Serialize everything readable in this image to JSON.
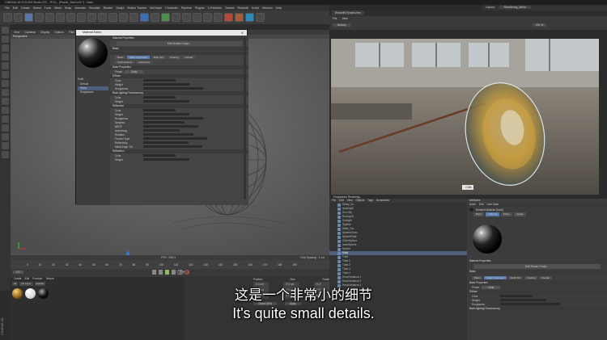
{
  "window": {
    "title": "CINEMA 4D R19.053 Studio (RC - R19) - [Plastic_Start.c4d *] - Main",
    "layout_label": "Layout:",
    "layout_value": "Rendering_direct"
  },
  "menu": [
    "File",
    "Edit",
    "Create",
    "Select",
    "Tools",
    "Mesh",
    "Snap",
    "Animate",
    "Simulate",
    "Render",
    "Sculpt",
    "Motion Tracker",
    "MoGraph",
    "Character",
    "Pipeline",
    "Plugins",
    "X-Particles",
    "Octane",
    "Redshift",
    "Script",
    "Window",
    "Help"
  ],
  "viewport": {
    "menu": [
      "View",
      "Cameras",
      "Display",
      "Options",
      "Filter",
      "Panel"
    ],
    "label": "Perspective",
    "fps": "FPS : 299.3",
    "grid": "Grid Spacing : 1 cm"
  },
  "timeline": {
    "ticks": [
      "0",
      "10",
      "20",
      "30",
      "40",
      "50",
      "60",
      "70",
      "80",
      "90",
      "100",
      "110",
      "120",
      "130",
      "140",
      "150",
      "160",
      "170",
      "180",
      "190"
    ],
    "frame_start": "0 F",
    "frame_end": "90 F"
  },
  "material_manager": {
    "menu": [
      "Create",
      "Edit",
      "Function",
      "Texture"
    ],
    "tabs": [
      "All",
      "No Layer",
      "Default"
    ]
  },
  "coordinates": {
    "headers": [
      "Position",
      "Size",
      "Rotation"
    ],
    "rows": [
      [
        "X  0 cm",
        "X  0 cm",
        "H  0°"
      ],
      [
        "Y  0 cm",
        "Y  0 cm",
        "P  0°"
      ],
      [
        "Z  0 cm",
        "Z  0 cm",
        "B  0°"
      ]
    ],
    "apply": "Apply",
    "mode": "Object (Rel)"
  },
  "material_editor": {
    "title": "Material Editor",
    "name_label": "Solid",
    "left_tabs": [
      "Default",
      "Glass",
      "Sunglasses"
    ],
    "basic_properties": "Material Properties",
    "shader_graph_button": "Edit Shader Graph...",
    "sections": [
      "Basic",
      "Base Properties",
      "Diffuse",
      "Reflection",
      "Refraction",
      "Transmission"
    ],
    "tabs": [
      "Basic",
      "Base Properties",
      "Multi (GI)",
      "Coating",
      "Overall"
    ],
    "sub_tabs": [
      "Optimizations",
      "Advanced"
    ],
    "preset": "Preset",
    "preset_value": "Solid",
    "rows_diffuse": [
      "Color",
      "Weight",
      "Roughness"
    ],
    "back_lighting": "Back-lighting/Translucency",
    "rows_back": [
      "Color",
      "Weight"
    ],
    "rows_reflection": [
      "Color",
      "Weight",
      "Roughness",
      "Samples",
      "BRDF",
      "Anisotropy",
      "Rotation",
      "Fresnel Type",
      "Reflectivity",
      "Metal Edge Tint"
    ],
    "rows_refraction": [
      "Color",
      "Weight"
    ],
    "fresnel_value": "Edge Tint",
    "brdf_value": "GGX"
  },
  "render_view": {
    "tab": "Redshift RenderView",
    "menu": [
      "File",
      "View"
    ],
    "beauty": "Beauty",
    "zoom": "100 %",
    "time": "2.26s",
    "status": "Progressive Rendering..."
  },
  "object_manager": {
    "menu": [
      "File",
      "Edit",
      "View",
      "Objects",
      "Tags",
      "Bookmarks"
    ],
    "objects": [
      "Sticky_Dr...",
      "SpotLight",
      "Sun Obj",
      "SunLight1",
      "Sunlight",
      "SkyBox",
      "Walls_Ha...",
      "SphereZoom",
      "SpherePlate",
      "OuterSphere",
      "InnerSphere",
      "Sphere",
      "Solid",
      "Tube",
      "Tube.1",
      "Tube.2",
      "Tube.3",
      "Tube.4",
      "Head Instance.1",
      "Head Instance.2",
      "Head Instance.3"
    ]
  },
  "attribute_manager": {
    "title": "Attributes",
    "menu": [
      "Mode",
      "Edit",
      "User Data"
    ],
    "material_name": "Redshift Material [Solid]",
    "tabs": [
      "Basic",
      "Material",
      "Editor",
      "Assign"
    ],
    "section": "Material Properties",
    "button": "Edit Shader Graph...",
    "preset": "Preset",
    "preset_value": "Solid",
    "rows": [
      "Color",
      "Weight",
      "Roughness"
    ],
    "back": "Back-lighting/Translucency"
  },
  "subtitles": {
    "cn": "这是一个非常小的细节",
    "en": "It's quite small details."
  },
  "watermark": "CINEMA 4D"
}
